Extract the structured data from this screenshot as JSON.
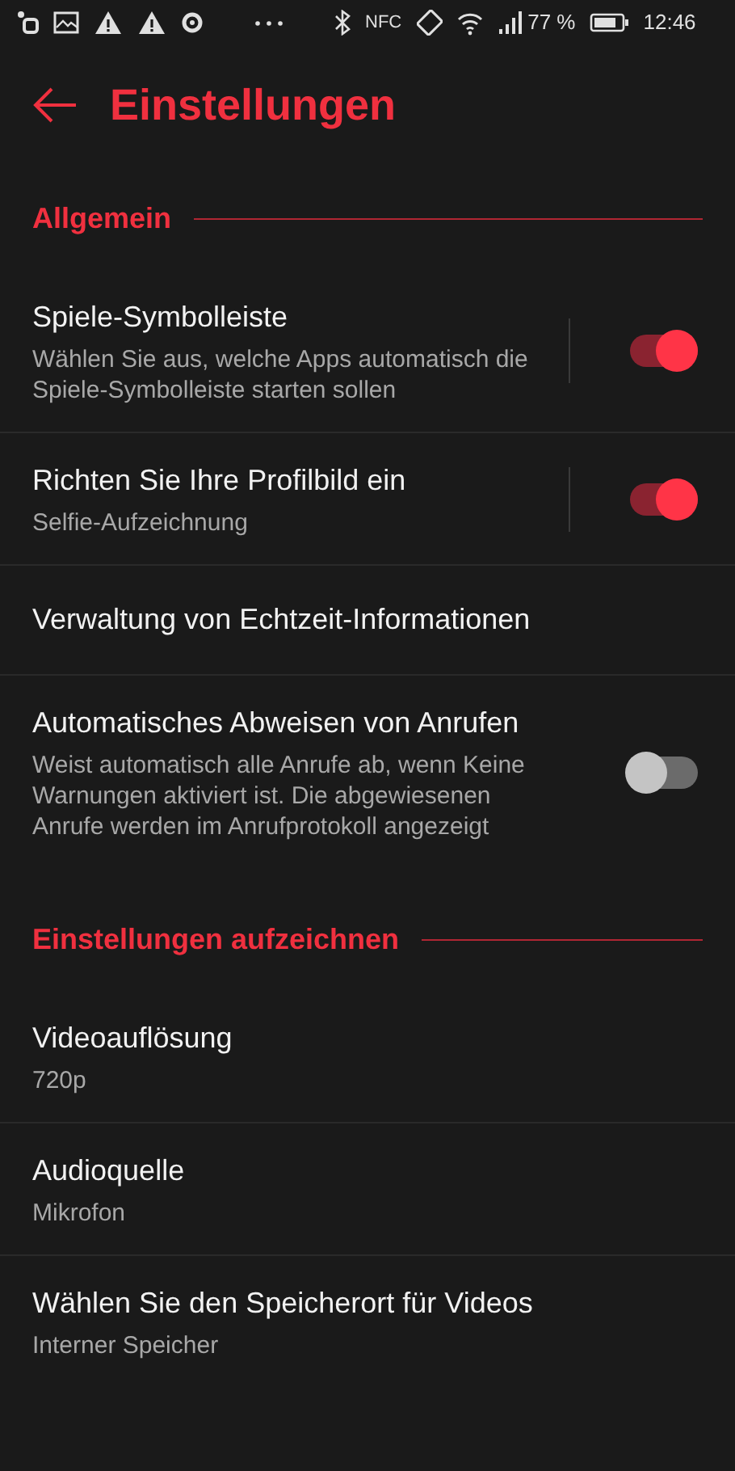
{
  "status_bar": {
    "nfc": "NFC",
    "battery": "77 %",
    "time": "12:46"
  },
  "header": {
    "title": "Einstellungen"
  },
  "sections": [
    {
      "title": "Allgemein",
      "items": [
        {
          "kind": "switch",
          "title": "Spiele-Symbolleiste",
          "subtitle": "Wählen Sie aus, welche Apps automatisch die Spiele-Symbolleiste starten sollen",
          "on": true,
          "divider": true
        },
        {
          "kind": "switch",
          "title": "Richten Sie Ihre Profilbild ein",
          "subtitle": "Selfie-Aufzeichnung",
          "on": true,
          "divider": true
        },
        {
          "kind": "nav",
          "title": "Verwaltung von Echtzeit-Informationen"
        },
        {
          "kind": "switch",
          "title": "Automatisches Abweisen von Anrufen",
          "subtitle": "Weist automatisch alle Anrufe ab, wenn Keine Warnungen aktiviert ist. Die abgewiesenen Anrufe werden im Anrufprotokoll angezeigt",
          "on": false,
          "divider": false
        }
      ]
    },
    {
      "title": "Einstellungen aufzeichnen",
      "items": [
        {
          "kind": "nav",
          "title": "Videoauflösung",
          "subtitle": "720p"
        },
        {
          "kind": "nav",
          "title": "Audioquelle",
          "subtitle": "Mikrofon"
        },
        {
          "kind": "nav",
          "title": "Wählen Sie den Speicherort für Videos",
          "subtitle": "Interner Speicher"
        }
      ]
    }
  ]
}
